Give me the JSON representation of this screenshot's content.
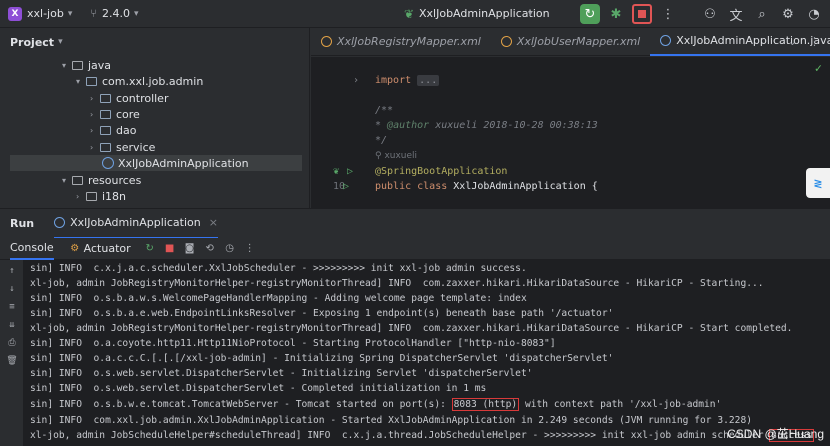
{
  "topbar": {
    "project_badge": "X",
    "project_name": "xxl-job",
    "version": "2.4.0",
    "run_config": "XxlJobAdminApplication"
  },
  "project_panel": {
    "title": "Project",
    "tree": [
      {
        "label": "java"
      },
      {
        "label": "com.xxl.job.admin"
      },
      {
        "label": "controller"
      },
      {
        "label": "core"
      },
      {
        "label": "dao"
      },
      {
        "label": "service"
      },
      {
        "label": "XxlJobAdminApplication"
      },
      {
        "label": "resources"
      },
      {
        "label": "i18n"
      }
    ]
  },
  "editor": {
    "tabs": [
      {
        "label": "XxlJobRegistryMapper.xml"
      },
      {
        "label": "XxlJobUserMapper.xml"
      },
      {
        "label": "XxlJobAdminApplication.java"
      }
    ],
    "lines": {
      "import_kw": "import",
      "import_fold": "...",
      "doc_open": "/**",
      "author_tag": "@author",
      "author_text": " xuxueli 2018-10-28 00:38:13",
      "doc_close": " */",
      "inlay_user": "xuxueli",
      "annotation": "@SpringBootApplication",
      "line_number": "10",
      "class_decl_kw": "public class",
      "class_decl_rest": " XxlJobAdminApplication {"
    }
  },
  "run_panel": {
    "label": "Run",
    "run_tab": "XxlJobAdminApplication",
    "console_tab": "Console",
    "actuator_tab": "Actuator"
  },
  "console": {
    "lines": [
      "sin] INFO  c.x.j.a.c.scheduler.XxlJobScheduler - >>>>>>>>> init xxl-job admin success.",
      "xl-job, admin JobRegistryMonitorHelper-registryMonitorThread] INFO  com.zaxxer.hikari.HikariDataSource - HikariCP - Starting...",
      "sin] INFO  o.s.b.a.w.s.WelcomePageHandlerMapping - Adding welcome page template: index",
      "sin] INFO  o.s.b.a.e.web.EndpointLinksResolver - Exposing 1 endpoint(s) beneath base path '/actuator'",
      "xl-job, admin JobRegistryMonitorHelper-registryMonitorThread] INFO  com.zaxxer.hikari.HikariDataSource - HikariCP - Start completed.",
      "sin] INFO  o.a.coyote.http11.Http11NioProtocol - Starting ProtocolHandler [\"http-nio-8083\"]",
      "sin] INFO  o.a.c.c.C.[.[.[/xxl-job-admin] - Initializing Spring DispatcherServlet 'dispatcherServlet'",
      "sin] INFO  o.s.web.servlet.DispatcherServlet - Initializing Servlet 'dispatcherServlet'",
      "sin] INFO  o.s.web.servlet.DispatcherServlet - Completed initialization in 1 ms"
    ],
    "tomcat_prefix": "sin] INFO  o.s.b.w.e.tomcat.TomcatWebServer - Tomcat started on port(s): ",
    "tomcat_port": "8083 (http)",
    "tomcat_suffix": " with context path '/xxl-job-admin'",
    "started_line": "sin] INFO  com.xxl.job.admin.XxlJobAdminApplication - Started XxlJobAdminApplication in 2.249 seconds (JVM running for 3.228)",
    "last_prefix": "xl-job, admin JobScheduleHelper#scheduleThread] INFO  c.x.j.a.thread.JobScheduleHelper - >>>>>>>>> init xxl-job admin scheduler ",
    "last_highlight": "success"
  },
  "watermark": "CSDN @茁Huang",
  "colors": {
    "accent": "#3574f0",
    "run_green": "#4f9f5a",
    "stop_red": "#e05555",
    "highlight_border": "#d83a3a"
  }
}
